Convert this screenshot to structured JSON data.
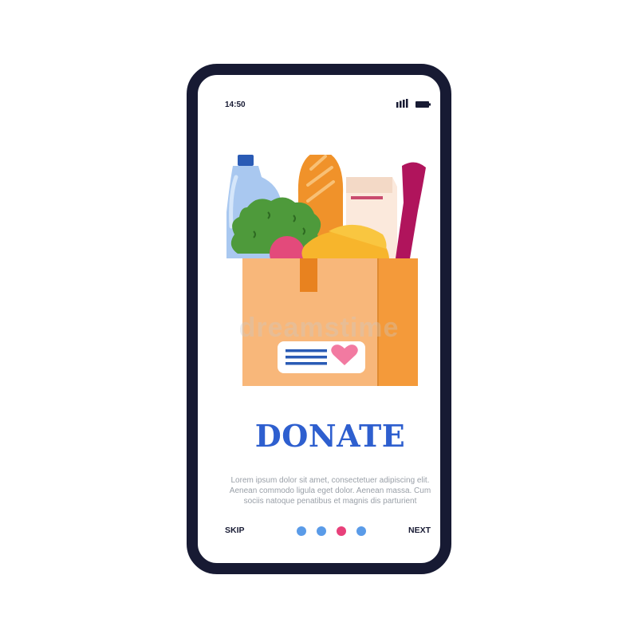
{
  "status_bar": {
    "time": "14:50",
    "signal_icon": "signal-bars-icon",
    "battery_icon": "battery-icon"
  },
  "illustration": {
    "name": "donation-box-illustration"
  },
  "title": "DONATE",
  "body_text": "Lorem ipsum dolor sit amet, consectetuer adipiscing elit. Aenean commodo ligula eget dolor. Aenean massa. Cum sociis natoque penatibus et magnis dis parturient",
  "nav": {
    "skip_label": "SKIP",
    "next_label": "NEXT",
    "dots": [
      {
        "active": false
      },
      {
        "active": false
      },
      {
        "active": true
      },
      {
        "active": false
      }
    ]
  },
  "watermark": "dreamstime",
  "colors": {
    "frame": "#171a33",
    "title": "#2e5fcf",
    "dot": "#5a9be8",
    "dot_active": "#e8407a"
  }
}
